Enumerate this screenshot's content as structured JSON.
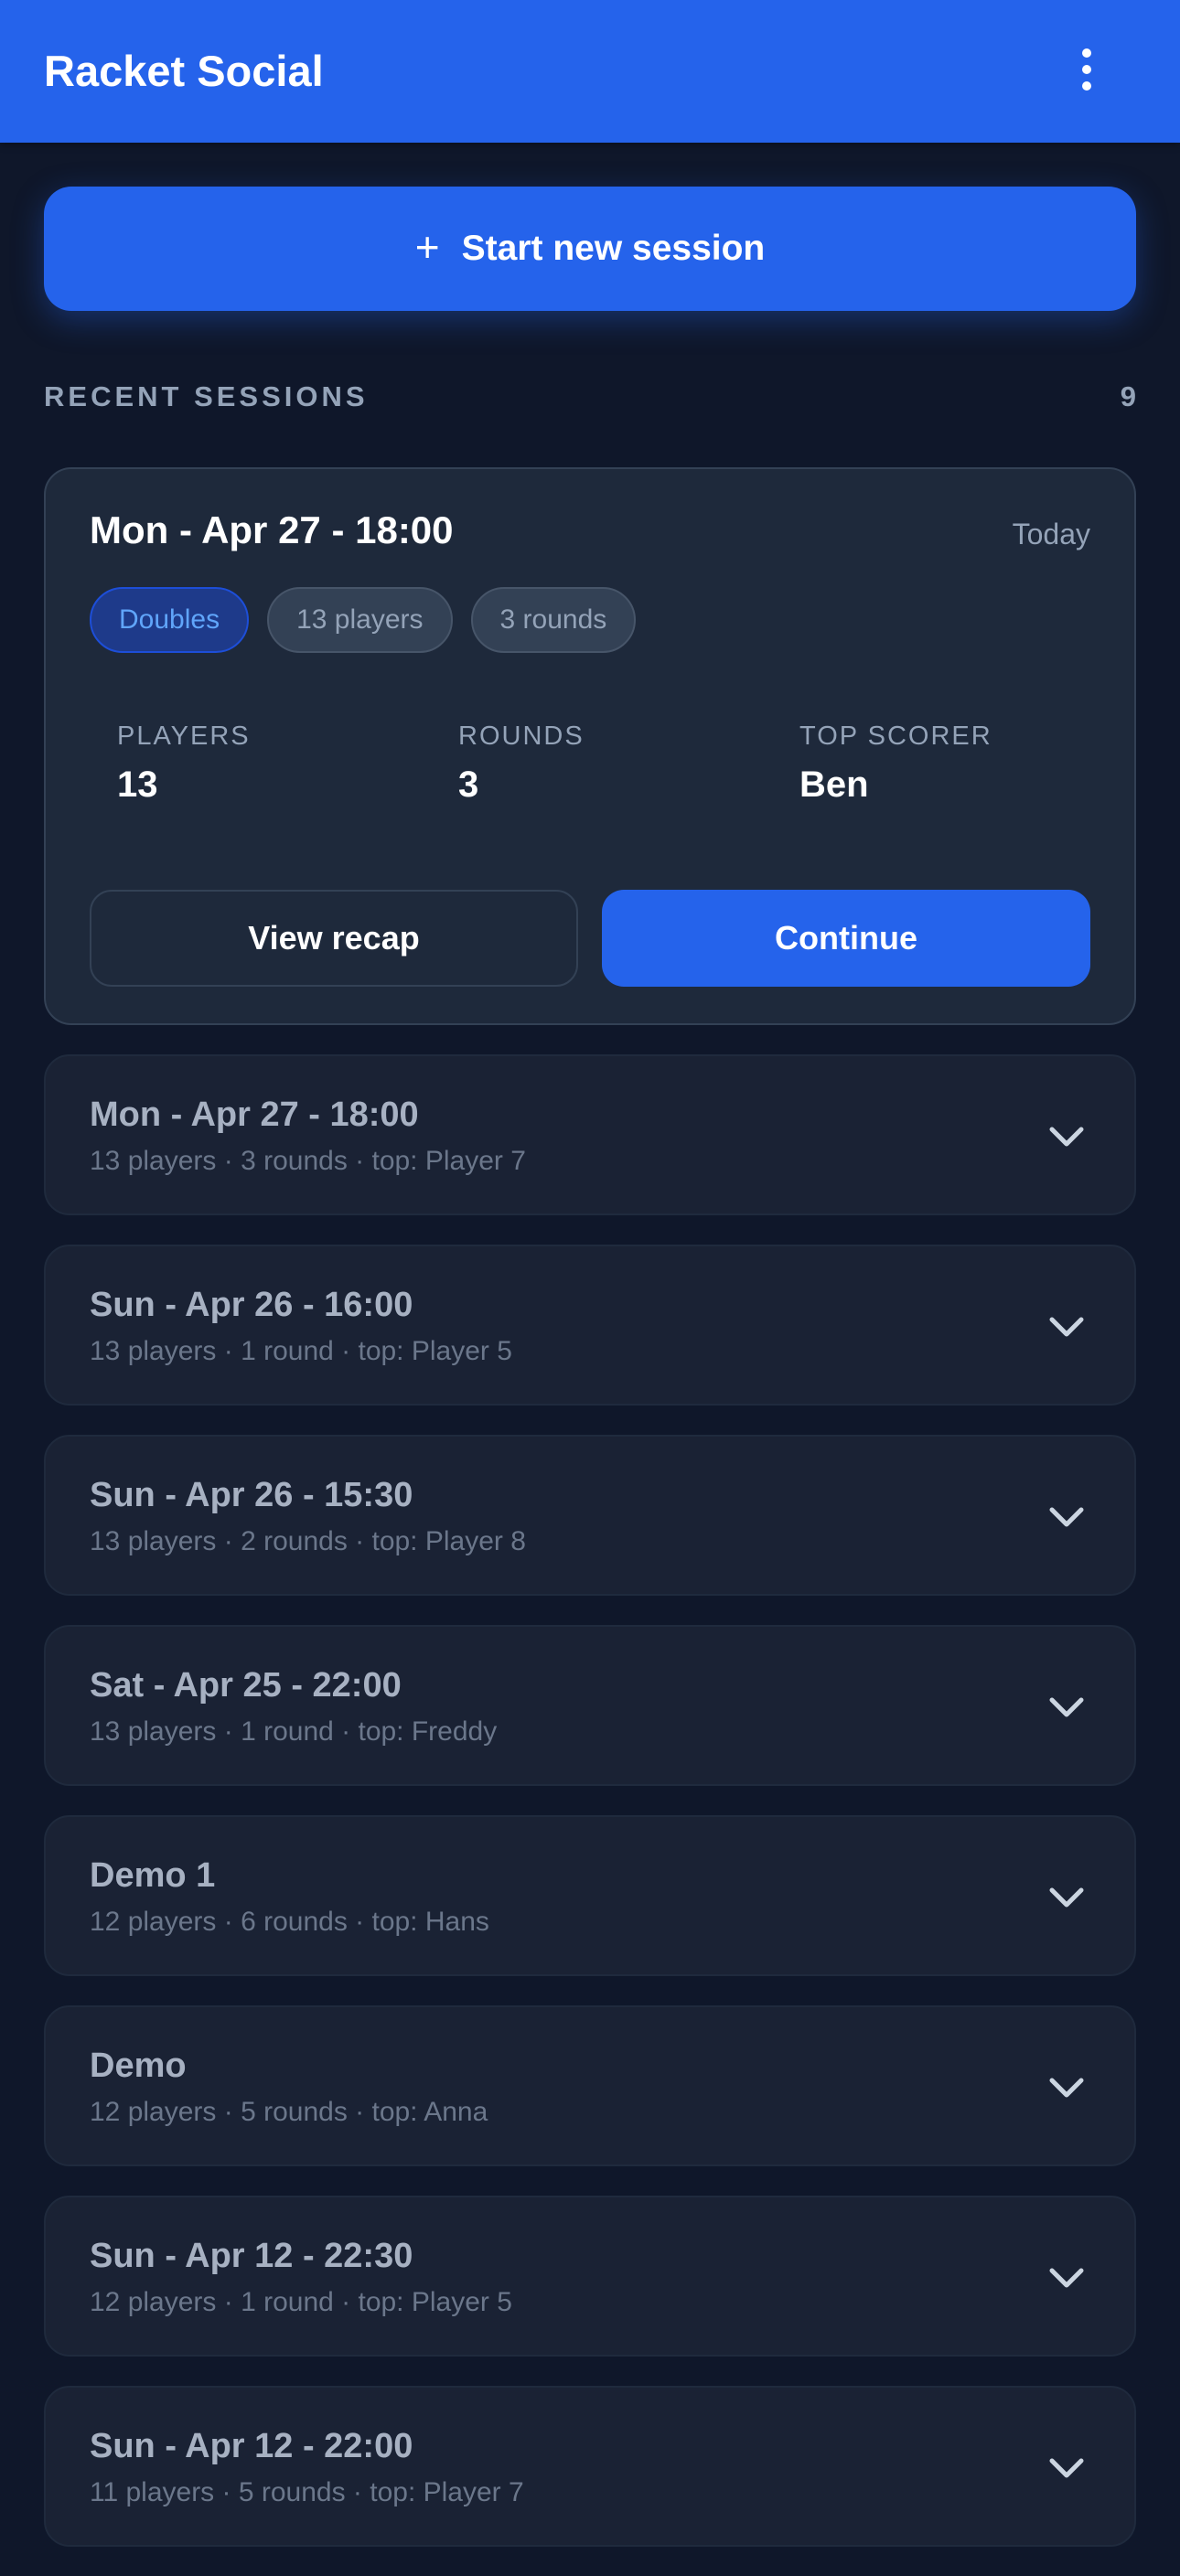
{
  "app": {
    "title": "Racket Social"
  },
  "actions": {
    "new_session_label": "Start new session"
  },
  "section": {
    "title": "RECENT SESSIONS",
    "count": "9"
  },
  "featured": {
    "title": "Mon - Apr 27 - 18:00",
    "when": "Today",
    "chips": [
      "Doubles",
      "13 players",
      "3 rounds"
    ],
    "stats": [
      {
        "label": "PLAYERS",
        "value": "13"
      },
      {
        "label": "ROUNDS",
        "value": "3"
      },
      {
        "label": "TOP SCORER",
        "value": "Ben"
      }
    ],
    "recap_label": "View recap",
    "continue_label": "Continue"
  },
  "sessions": [
    {
      "title": "Mon - Apr 27 - 18:00",
      "meta": "13 players · 3 rounds · top: Player 7"
    },
    {
      "title": "Sun - Apr 26 - 16:00",
      "meta": "13 players · 1 round · top: Player 5"
    },
    {
      "title": "Sun - Apr 26 - 15:30",
      "meta": "13 players · 2 rounds · top: Player 8"
    },
    {
      "title": "Sat - Apr 25 - 22:00",
      "meta": "13 players · 1 round · top: Freddy"
    },
    {
      "title": "Demo 1",
      "meta": "12 players · 6 rounds · top: Hans"
    },
    {
      "title": "Demo",
      "meta": "12 players · 5 rounds · top: Anna"
    },
    {
      "title": "Sun - Apr 12 - 22:30",
      "meta": "12 players · 1 round · top: Player 5"
    },
    {
      "title": "Sun - Apr 12 - 22:00",
      "meta": "11 players · 5 rounds · top: Player 7"
    }
  ],
  "icons": {
    "menu": "more-vertical-icon",
    "plus": "plus-icon",
    "expand": "chevron-down-icon"
  },
  "colors": {
    "brand": "#2563eb",
    "background": "#0f172a",
    "card": "#1e293b",
    "chip_accent_text": "#60a5fa"
  }
}
